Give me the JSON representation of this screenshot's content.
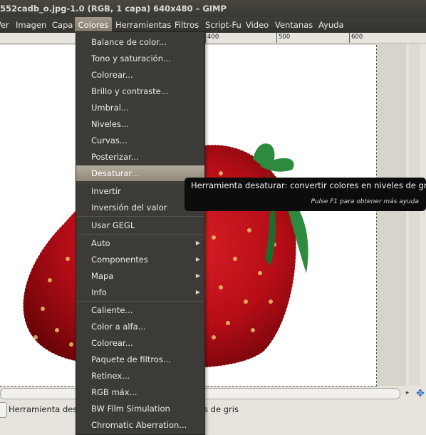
{
  "window": {
    "title": "552cadb_o.jpg-1.0 (RGB, 1 capa) 640x480 – GIMP"
  },
  "menubar": {
    "items": [
      "Ver",
      "Imagen",
      "Capa",
      "Colores",
      "Herramientas",
      "Filtros",
      "Script-Fu",
      "Video",
      "Ventanas",
      "Ayuda"
    ],
    "active": "Colores"
  },
  "ruler": {
    "labels": [
      "400",
      "500",
      "600"
    ]
  },
  "colors_menu": {
    "items": [
      {
        "label": "Balance de color...",
        "submenu": false
      },
      {
        "label": "Tono y saturación...",
        "submenu": false
      },
      {
        "label": "Colorear...",
        "submenu": false
      },
      {
        "label": "Brillo y contraste...",
        "submenu": false
      },
      {
        "label": "Umbral...",
        "submenu": false
      },
      {
        "label": "Niveles...",
        "submenu": false
      },
      {
        "label": "Curvas...",
        "submenu": false
      },
      {
        "label": "Posterizar...",
        "submenu": false
      },
      {
        "label": "Desaturar...",
        "submenu": false,
        "highlighted": true
      },
      {
        "label": "Invertir",
        "submenu": false
      },
      {
        "label": "Inversión del valor",
        "submenu": false
      },
      {
        "label": "Usar GEGL",
        "submenu": false
      },
      {
        "label": "Auto",
        "submenu": true
      },
      {
        "label": "Componentes",
        "submenu": true
      },
      {
        "label": "Mapa",
        "submenu": true
      },
      {
        "label": "Info",
        "submenu": true
      },
      {
        "label": "Caliente...",
        "submenu": false
      },
      {
        "label": "Color a alfa...",
        "submenu": false
      },
      {
        "label": "Colorear...",
        "submenu": false
      },
      {
        "label": "Paquete de filtros...",
        "submenu": false
      },
      {
        "label": "Retinex...",
        "submenu": false
      },
      {
        "label": "RGB máx...",
        "submenu": false
      },
      {
        "label": "BW Film Simulation",
        "submenu": false
      },
      {
        "label": "Chromatic Aberration...",
        "submenu": false
      }
    ]
  },
  "tooltip": {
    "text": "Herramienta desaturar: convertir colores en niveles de gris",
    "hint": "Pulse F1 para obtener más ayuda"
  },
  "statusbar": {
    "text_left": "Herramienta desa",
    "text_right": "s de gris"
  },
  "icons": {
    "submenu_arrow": "chevron-right-icon",
    "navigate": "navigate-move-icon",
    "status_dropdown": "dropdown-icon"
  },
  "accent": {
    "menu_bg": "#3d3b37",
    "highlight": "#a19a8c",
    "tooltip_bg": "#0c0c0c",
    "strawberry": "#c8101a",
    "leaf": "#2e8a3e"
  }
}
